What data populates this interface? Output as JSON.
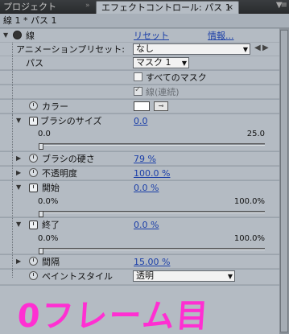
{
  "tabs": {
    "project": "プロジェクト",
    "effect_controls": "エフェクトコントロール: パス 1",
    "close": "×",
    "menu": "▼≡"
  },
  "breadcrumb": "線 1 * パス 1",
  "effect": {
    "name": "線",
    "reset": "リセット",
    "about": "情報..."
  },
  "animation_preset": {
    "label": "アニメーションプリセット:",
    "value": "なし"
  },
  "path": {
    "label": "パス",
    "value": "マスク 1"
  },
  "all_masks": {
    "label": "すべてのマスク",
    "checked": false
  },
  "stroke_sequential": {
    "label": "線(連続)",
    "checked": true
  },
  "color": {
    "label": "カラー",
    "swatch": "#ffffff"
  },
  "brush_size": {
    "label": "ブラシのサイズ",
    "value": "0.0",
    "min": "0.0",
    "max": "25.0",
    "level": 0
  },
  "brush_hardness": {
    "label": "ブラシの硬さ",
    "value": "79 %"
  },
  "opacity": {
    "label": "不透明度",
    "value": "100.0 %"
  },
  "start": {
    "label": "開始",
    "value": "0.0 %",
    "min": "0.0%",
    "max": "100.0%",
    "level": 0
  },
  "end": {
    "label": "終了",
    "value": "0.0 %",
    "min": "0.0%",
    "max": "100.0%",
    "level": 0
  },
  "spacing": {
    "label": "間隔",
    "value": "15.00 %"
  },
  "paint_style": {
    "label": "ペイントスタイル",
    "value": "透明"
  },
  "annotation": "0フレーム目"
}
